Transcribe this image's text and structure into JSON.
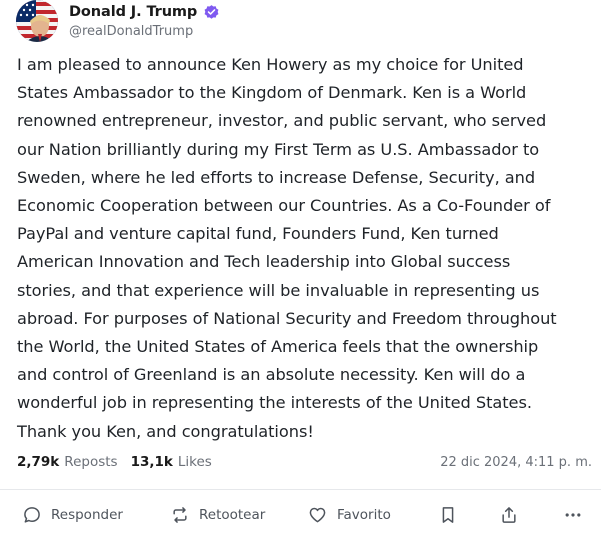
{
  "author": {
    "name": "Donald J. Trump",
    "handle": "@realDonaldTrump",
    "avatar_icon": "flag-avatar-icon",
    "verified_icon": "verified-badge-icon"
  },
  "post": {
    "text": "I am pleased to announce Ken Howery as my choice for United\nStates Ambassador to the Kingdom of Denmark. Ken is a World\nrenowned entrepreneur, investor, and public servant, who served\nour Nation brilliantly during my First Term as U.S. Ambassador to\nSweden, where he led efforts to increase Defense, Security, and\nEconomic Cooperation between our Countries. As a Co-Founder of\nPayPal and venture capital fund, Founders Fund, Ken turned\nAmerican Innovation and Tech leadership into Global success\nstories, and that experience will be invaluable in representing us\nabroad. For purposes of National Security and Freedom throughout\nthe World, the United States of America feels that the ownership\nand control of Greenland is an absolute necessity. Ken will do a\nwonderful job in representing the interests of the United States.\nThank you Ken, and congratulations!"
  },
  "stats": {
    "reposts_count": "2,79k",
    "reposts_label": "Reposts",
    "likes_count": "13,1k",
    "likes_label": "Likes",
    "timestamp": "22 dic 2024, 4:11 p. m."
  },
  "actions": {
    "reply_label": "Responder",
    "repost_label": "Retootear",
    "like_label": "Favorito"
  },
  "colors": {
    "verified": "#7f5af0",
    "text": "#1f2328",
    "muted": "#6b7078"
  }
}
